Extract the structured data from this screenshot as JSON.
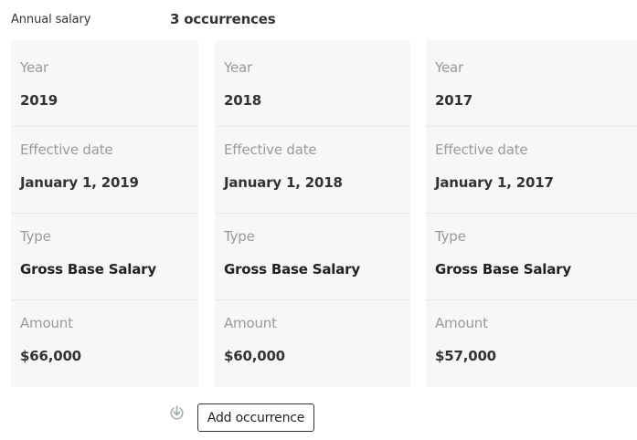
{
  "section": {
    "label": "Annual salary",
    "occurrence_count": "3 occurrences"
  },
  "field_labels": {
    "year": "Year",
    "effective_date": "Effective date",
    "type": "Type",
    "amount": "Amount"
  },
  "occurrences": [
    {
      "year": "2019",
      "effective_date": "January 1, 2019",
      "type": "Gross Base Salary",
      "amount": "$66,000"
    },
    {
      "year": "2018",
      "effective_date": "January 1, 2018",
      "type": "Gross Base Salary",
      "amount": "$60,000"
    },
    {
      "year": "2017",
      "effective_date": "January 1, 2017",
      "type": "Gross Base Salary",
      "amount": "$57,000"
    }
  ],
  "actions": {
    "download_icon": "download-icon",
    "add_label": "Add occurrence"
  },
  "colors": {
    "card_background": "#f6f7f7",
    "label_gray": "#9a9a9a",
    "text_dark": "#333333"
  }
}
